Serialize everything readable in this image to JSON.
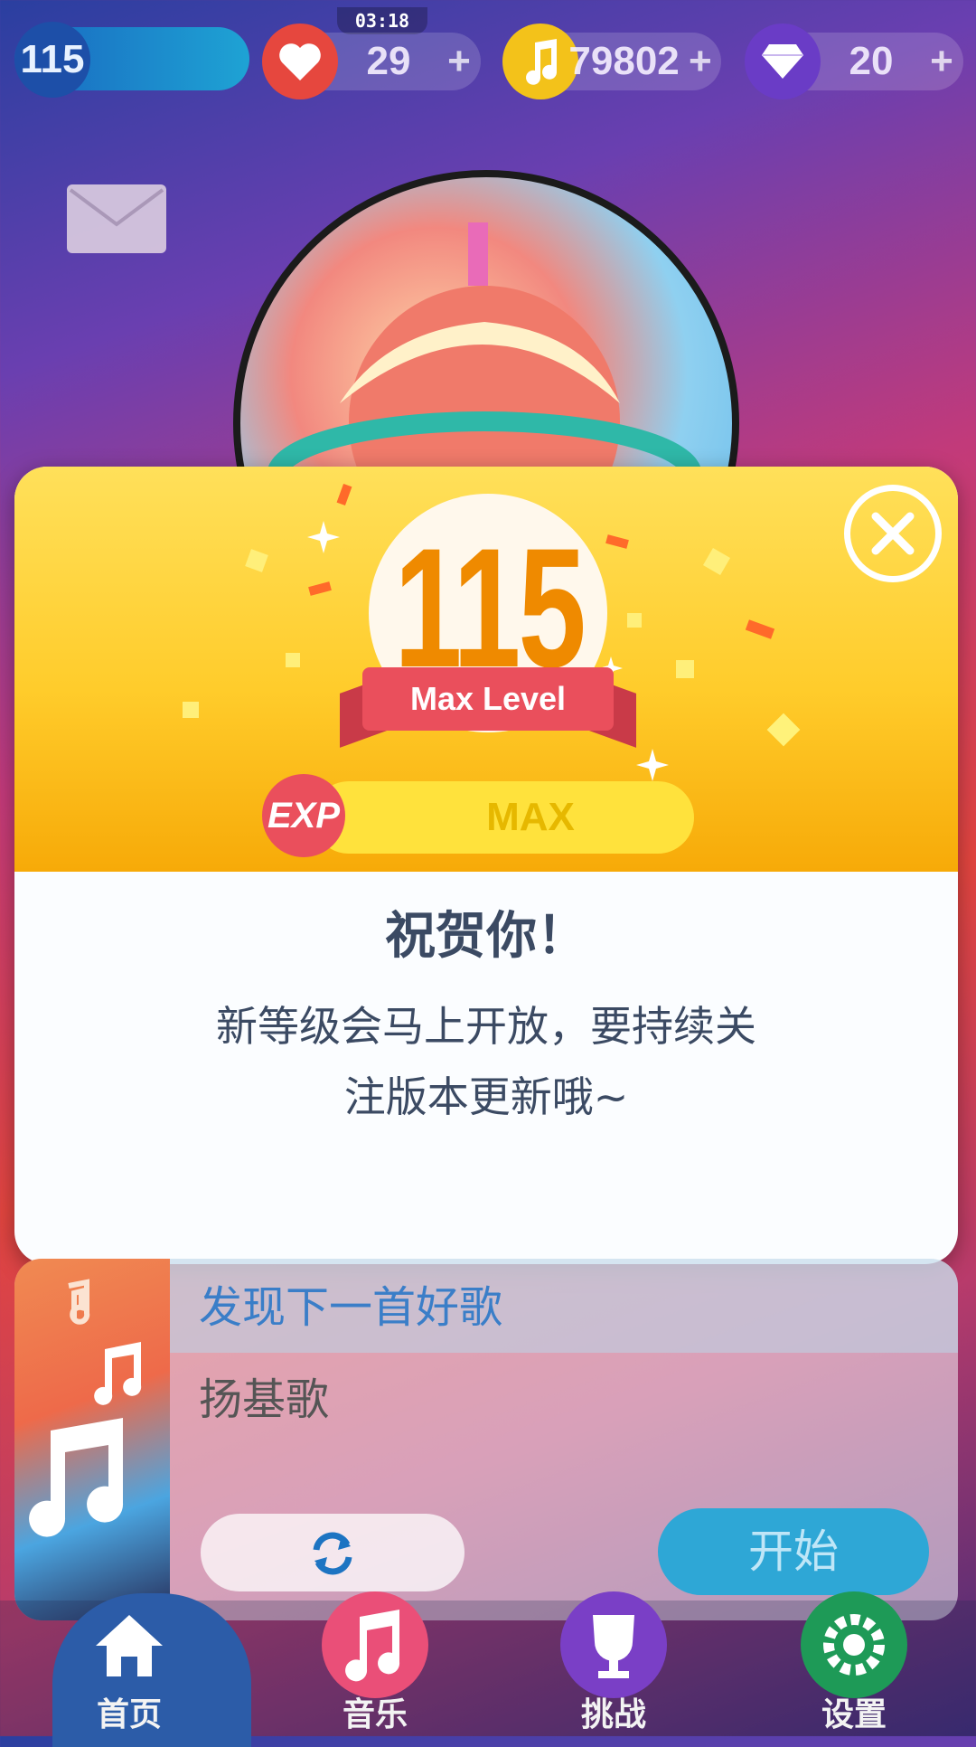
{
  "status": {
    "clock": "03:18"
  },
  "topbar": {
    "level": "115",
    "lives": "29",
    "notes": "79802",
    "gems": "20",
    "plus": "+"
  },
  "modal": {
    "level": "115",
    "ribbon": "Max Level",
    "exp_badge": "EXP",
    "exp_value": "MAX",
    "title": "祝贺你！",
    "message_line1": "新等级会马上开放，要持续关",
    "message_line2": "注版本更新哦~"
  },
  "card": {
    "title": "发现下一首好歌",
    "song": "扬基歌",
    "start_label": "开始"
  },
  "nav": {
    "home": "首页",
    "music": "音乐",
    "challenge": "挑战",
    "settings": "设置"
  },
  "colors": {
    "accent_yellow": "#ffcc2b",
    "ribbon_red": "#ea4f5c",
    "level_orange": "#ef8a00",
    "start_blue": "#2ea7d6",
    "nav_home": "#2c5ca8",
    "nav_music": "#ea4f78",
    "nav_challenge": "#7a3fc6",
    "nav_settings": "#1e9a57"
  }
}
